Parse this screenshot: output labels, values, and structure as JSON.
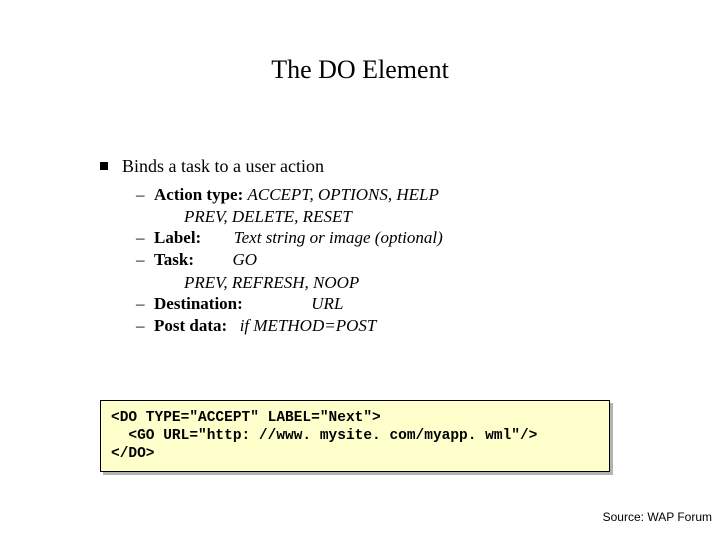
{
  "title": "The DO Element",
  "main_bullet": "Binds a task to a user action",
  "sub_items": [
    {
      "label": "Action type:",
      "value": "ACCEPT, OPTIONS, HELP",
      "continuation": "PREV, DELETE, RESET",
      "label_width": "160px"
    },
    {
      "label": "Label:",
      "value": "Text string or image (optional)",
      "label_width": "82px"
    },
    {
      "label": "Task:",
      "value": "GO",
      "continuation": "PREV, REFRESH, NOOP",
      "label_width": "82px"
    },
    {
      "label": "Destination:",
      "value": "URL",
      "label_width": "160px"
    },
    {
      "label": "Post data:",
      "value": "if METHOD=POST",
      "label_width": "82px"
    }
  ],
  "code": "<DO TYPE=\"ACCEPT\" LABEL=\"Next\">\n  <GO URL=\"http: //www. mysite. com/myapp. wml\"/>\n</DO>",
  "source": "Source: WAP Forum"
}
